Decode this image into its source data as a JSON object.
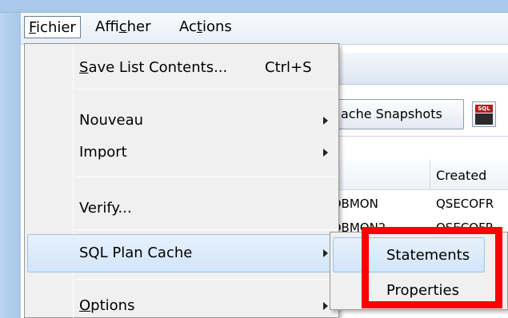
{
  "menubar": {
    "items": [
      {
        "pre": "",
        "mn": "F",
        "post": "ichier"
      },
      {
        "pre": "Affi",
        "mn": "c",
        "post": "her"
      },
      {
        "pre": "Ac",
        "mn": "t",
        "post": "ions"
      }
    ]
  },
  "toolbar": {
    "cache_snapshots_label": "ache Snapshots",
    "sql_icon_text": "SQL"
  },
  "list": {
    "headers": [
      "e",
      "Created"
    ],
    "rows": [
      [
        "DBMON",
        "QSECOFR"
      ],
      [
        "DBMON2",
        "QSECOFR"
      ],
      [
        "",
        "R"
      ],
      [
        "",
        "R"
      ]
    ]
  },
  "dropdown": {
    "items": [
      {
        "pre": "",
        "mn": "S",
        "post": "ave List Contents...",
        "shortcut": "Ctrl+S"
      },
      {
        "pre": "Nouveau",
        "mn": "",
        "post": ""
      },
      {
        "pre": "Import",
        "mn": "",
        "post": ""
      },
      {
        "pre": "Verify...",
        "mn": "",
        "post": ""
      },
      {
        "pre": "SQL Plan Cache",
        "mn": "",
        "post": ""
      },
      {
        "pre": "",
        "mn": "O",
        "post": "ptions"
      }
    ]
  },
  "submenu": {
    "items": [
      "Statements",
      "Properties"
    ]
  },
  "colors": {
    "highlight_border": "#9dc2eb",
    "annotation_red": "#ff0000",
    "window_frame": "#a9c8ea"
  }
}
